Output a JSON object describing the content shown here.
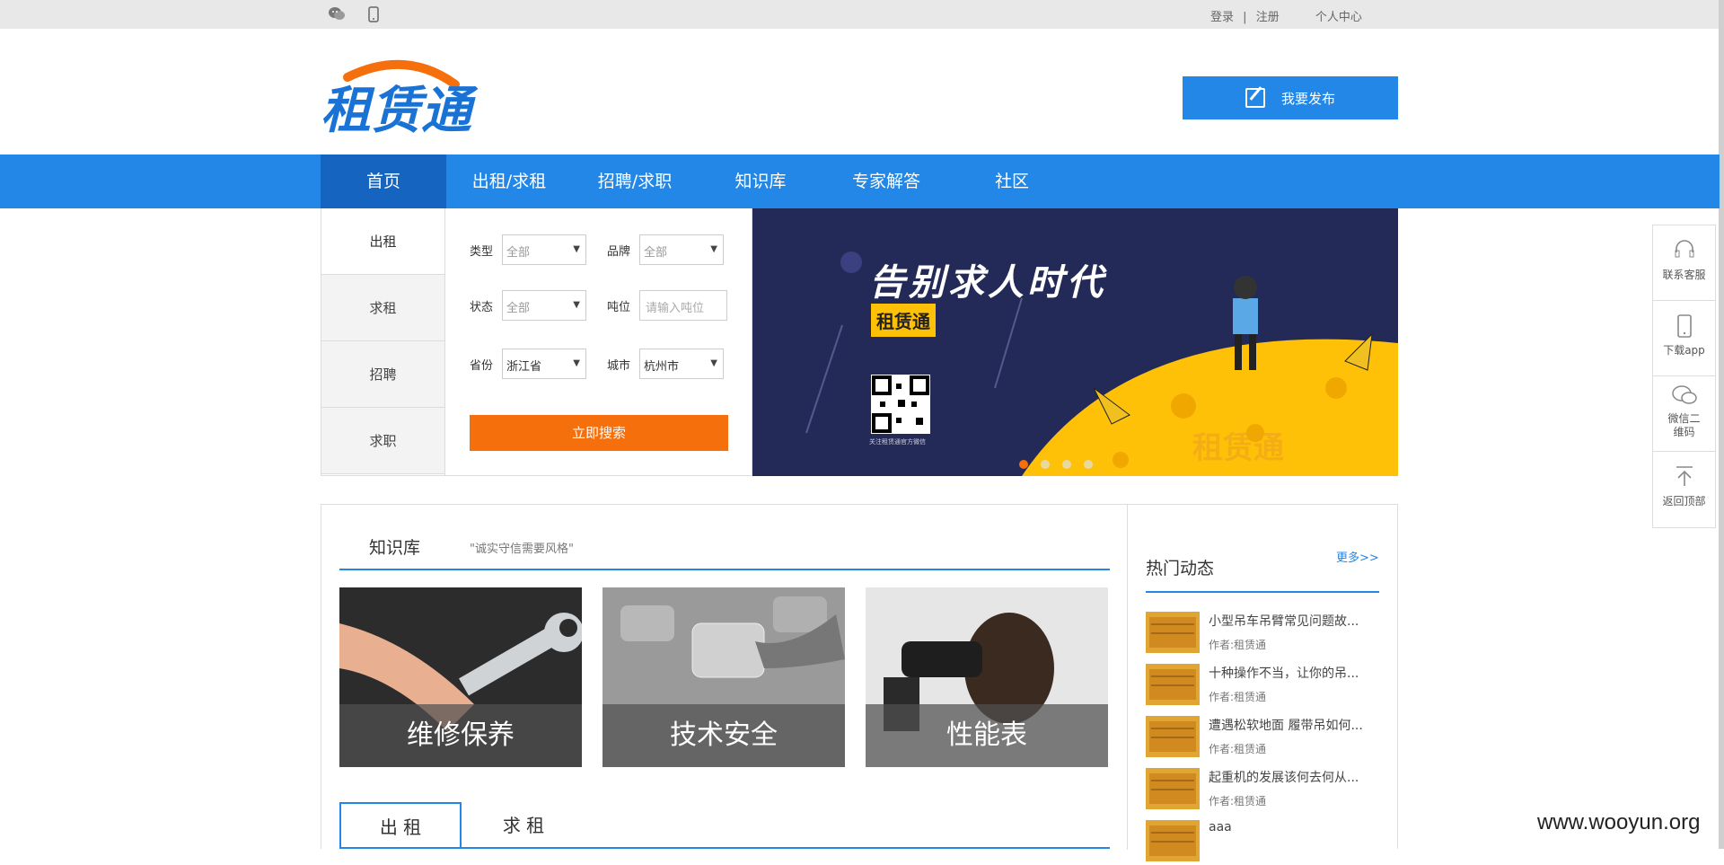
{
  "topbar": {
    "wechat_icon": "wechat-icon",
    "phone_icon": "mobile-phone-icon",
    "login": "登录",
    "sep": "|",
    "register": "注册",
    "personal_center": "个人中心"
  },
  "header": {
    "logo_text": "租赁通",
    "publish_label": "我要发布",
    "publish_icon": "edit-icon"
  },
  "nav": {
    "items": [
      {
        "label": "首页"
      },
      {
        "label": "出租/求租"
      },
      {
        "label": "招聘/求职"
      },
      {
        "label": "知识库"
      },
      {
        "label": "专家解答"
      },
      {
        "label": "社区"
      }
    ],
    "active_color": "#1565c0",
    "bar_color": "#2287e6"
  },
  "search": {
    "tabs": [
      {
        "label": "出租"
      },
      {
        "label": "求租"
      },
      {
        "label": "招聘"
      },
      {
        "label": "求职"
      }
    ],
    "fields": {
      "type_label": "类型",
      "type_value": "全部",
      "brand_label": "品牌",
      "brand_value": "全部",
      "status_label": "状态",
      "status_value": "全部",
      "tonnage_label": "吨位",
      "tonnage_placeholder": "请输入吨位",
      "province_label": "省份",
      "province_value": "浙江省",
      "city_label": "城市",
      "city_value": "杭州市"
    },
    "button_label": "立即搜索",
    "button_color": "#f56f0c"
  },
  "banner": {
    "headline": "告别求人时代",
    "badge": "租赁通",
    "qr_caption": "关注租赁通官方微信",
    "watermark_logo": "租赁通",
    "active_slide": 1,
    "slide_count": 4
  },
  "sidebar": {
    "items": [
      {
        "icon": "headset-icon",
        "label": "联系客服"
      },
      {
        "icon": "mobile-phone-icon",
        "label": "下载app"
      },
      {
        "icon": "wechat-icon",
        "label": "微信二维码"
      },
      {
        "icon": "arrow-up-icon",
        "label": "返回顶部"
      }
    ]
  },
  "knowledge": {
    "title": "知识库",
    "slogan": "\"诚实守信需要风格\"",
    "cards": [
      {
        "caption": "维修保养"
      },
      {
        "caption": "技术安全"
      },
      {
        "caption": "性能表"
      }
    ]
  },
  "rent_tabs": [
    {
      "label": "出  租"
    },
    {
      "label": "求  租"
    }
  ],
  "hot": {
    "title": "热门动态",
    "more": "更多>>",
    "items": [
      {
        "title": "小型吊车吊臂常见问题故...",
        "author": "作者:租赁通"
      },
      {
        "title": "十种操作不当，让你的吊...",
        "author": "作者:租赁通"
      },
      {
        "title": "遭遇松软地面 履带吊如何...",
        "author": "作者:租赁通"
      },
      {
        "title": "起重机的发展该何去何从...",
        "author": "作者:租赁通"
      },
      {
        "title": "aaa",
        "author": ""
      }
    ]
  },
  "watermark": "www.wooyun.org"
}
